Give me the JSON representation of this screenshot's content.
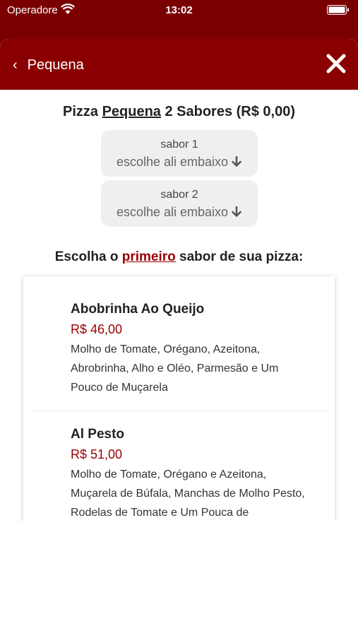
{
  "status_bar": {
    "carrier": "Operadore",
    "time": "13:02"
  },
  "header": {
    "back_label": "Pequena"
  },
  "title": {
    "prefix": "Pizza ",
    "size": "Pequena",
    "suffix": " 2 Sabores (R$ 0,00)"
  },
  "slots": [
    {
      "label": "sabor 1",
      "hint": "escolhe ali embaixo"
    },
    {
      "label": "sabor 2",
      "hint": "escolhe ali embaixo"
    }
  ],
  "prompt": {
    "prefix": "Escolha o ",
    "emphasis": "primeiro",
    "suffix": " sabor de sua pizza:"
  },
  "items": [
    {
      "name": "Abobrinha Ao Queijo",
      "price": "R$ 46,00",
      "description": "Molho de Tomate, Orégano, Azeitona, Abrobrinha, Alho e Oléo, Parmesão e Um Pouco de Muçarela"
    },
    {
      "name": "Al Pesto",
      "price": "R$ 51,00",
      "description": "Molho de Tomate, Orégano e Azeitona, Muçarela de Búfala, Manchas de Molho Pesto, Rodelas de Tomate e Um Pouca de"
    }
  ],
  "colors": {
    "brand": "#8a0000",
    "price": "#9a0000"
  },
  "icons": {
    "back": "chevron-left-icon",
    "close": "close-icon",
    "slot_arrow": "arrow-down-icon",
    "wifi": "wifi-icon",
    "battery": "battery-icon"
  }
}
